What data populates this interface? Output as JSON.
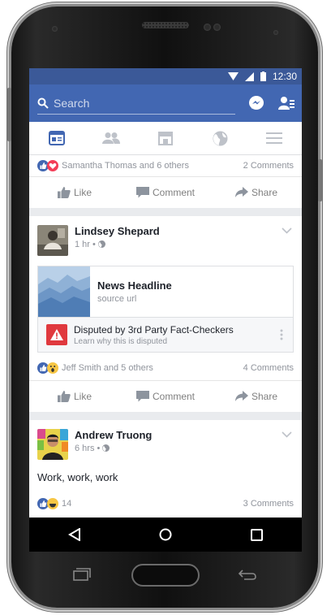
{
  "status": {
    "time": "12:30"
  },
  "search": {
    "label": "Search"
  },
  "post0": {
    "reaction_names": "Samantha Thomas and 6 others",
    "comments": "2 Comments"
  },
  "actions": {
    "like": "Like",
    "comment": "Comment",
    "share": "Share"
  },
  "post1": {
    "author": "Lindsey Shepard",
    "time": "1 hr •",
    "link_title": "News Headline",
    "link_source": "source url",
    "dispute_title": "Disputed by 3rd Party Fact-Checkers",
    "dispute_sub": "Learn why this is disputed",
    "reaction_names": "Jeff Smith and 5 others",
    "comments": "4 Comments"
  },
  "post2": {
    "author": "Andrew Truong",
    "time": "6 hrs •",
    "text": "Work, work, work",
    "reaction_count": "14",
    "comments": "3 Comments"
  },
  "colors": {
    "brand": "#4267b2",
    "status": "#3b5998",
    "warning": "#e0393e"
  }
}
